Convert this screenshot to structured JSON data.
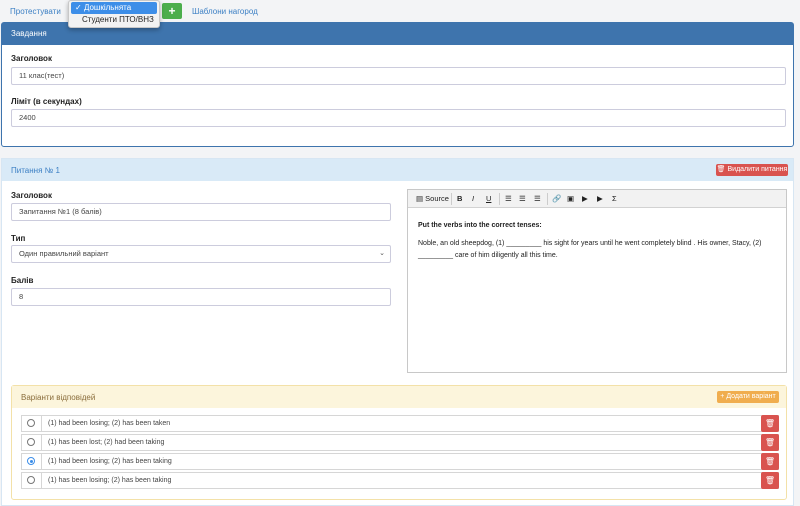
{
  "topbar": {
    "test_link": "Протестувати",
    "awards_link": "Шаблони нагород",
    "add_icon": "plus-icon",
    "dropdown": {
      "selected": "Дошкільнята",
      "options": [
        "Дошкільнята",
        "Студенти ПТО/ВНЗ"
      ]
    }
  },
  "task": {
    "header": "Завдання",
    "title_label": "Заголовок",
    "title_value": "11 клас(тест)",
    "limit_label": "Ліміт (в секундах)",
    "limit_value": "2400"
  },
  "question": {
    "header": "Питання № 1",
    "delete_label": "Видалити питання",
    "title_label": "Заголовок",
    "title_value": "Запитання №1 (8 балів)",
    "type_label": "Тип",
    "type_value": "Один правильний варіант",
    "points_label": "Балів",
    "points_value": "8"
  },
  "editor": {
    "source_label": "Source",
    "heading": "Put the verbs into the correct tenses:",
    "body": "Noble, an old sheepdog, (1) _________ his sight for years until he went completely blind . His owner, Stacy, (2) _________ care of him diligently all this time."
  },
  "answers": {
    "header": "Варіанти відповідей",
    "add_label": "Додати варіант",
    "items": [
      {
        "text": "(1) had been losing; (2) has been taken",
        "checked": false
      },
      {
        "text": "(1) has been lost; (2) had been taking",
        "checked": false
      },
      {
        "text": "(1) had been losing; (2) has been taking",
        "checked": true
      },
      {
        "text": "(1) has been losing; (2) has been taking",
        "checked": false
      }
    ]
  },
  "colors": {
    "primary": "#3e74ad",
    "danger": "#d9534f",
    "success": "#4cae4c",
    "warning": "#f0ad4e",
    "link": "#3b7fc4"
  }
}
